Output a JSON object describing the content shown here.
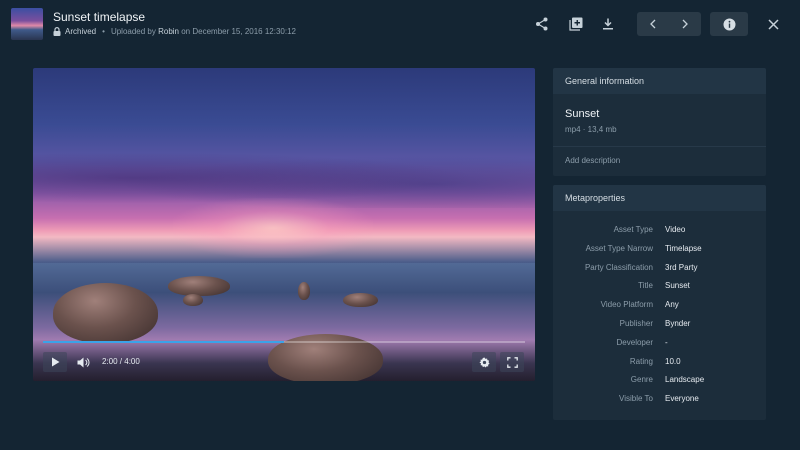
{
  "header": {
    "title": "Sunset timelapse",
    "status": "Archived",
    "separator": "•",
    "uploaded_prefix": "Uploaded by",
    "uploader": "Robin",
    "uploaded_suffix": "on December 15, 2016 12:30:12",
    "icons": [
      "share-icon",
      "add-to-collection-icon",
      "download-icon",
      "chevron-left-icon",
      "chevron-right-icon",
      "info-icon",
      "close-icon"
    ]
  },
  "player": {
    "current_time": "2:00",
    "duration": "4:00",
    "time_display": "2:00 / 4:00",
    "progress_fraction": 0.5,
    "icons": [
      "play-icon",
      "volume-icon",
      "settings-icon",
      "fullscreen-icon"
    ]
  },
  "general_info": {
    "heading": "General information",
    "asset_name": "Sunset",
    "asset_meta": "mp4 · 13,4 mb",
    "description_placeholder": "Add description"
  },
  "metaproperties": {
    "heading": "Metaproperties",
    "rows": [
      {
        "key": "Asset Type",
        "value": "Video"
      },
      {
        "key": "Asset Type Narrow",
        "value": "Timelapse"
      },
      {
        "key": "Party Classification",
        "value": "3rd Party"
      },
      {
        "key": "Title",
        "value": "Sunset"
      },
      {
        "key": "Video Platform",
        "value": "Any"
      },
      {
        "key": "Publisher",
        "value": "Bynder"
      },
      {
        "key": "Developer",
        "value": "-"
      },
      {
        "key": "Rating",
        "value": "10.0"
      },
      {
        "key": "Genre",
        "value": "Landscape"
      },
      {
        "key": "Visible To",
        "value": "Everyone"
      }
    ]
  },
  "colors": {
    "background": "#142533",
    "panel": "#1c2d3b",
    "accent": "#3ba3e8"
  }
}
